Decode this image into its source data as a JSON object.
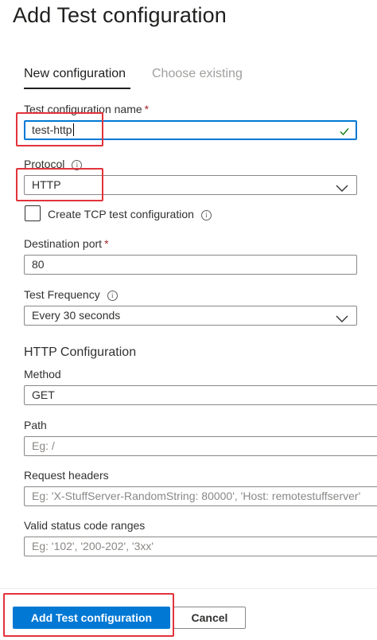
{
  "page_title": "Add Test configuration",
  "tabs": [
    {
      "label": "New configuration",
      "active": true
    },
    {
      "label": "Choose existing",
      "active": false
    }
  ],
  "form": {
    "name": {
      "label": "Test configuration name",
      "required_mark": "*",
      "value": "test-http"
    },
    "protocol": {
      "label": "Protocol",
      "info_icon": "i",
      "value": "HTTP"
    },
    "tcp_checkbox": {
      "label": "Create TCP test configuration",
      "info_icon": "i",
      "checked": false
    },
    "destination_port": {
      "label": "Destination port",
      "required_mark": "*",
      "value": "80"
    },
    "test_frequency": {
      "label": "Test Frequency",
      "info_icon": "i",
      "value": "Every 30 seconds"
    },
    "http_section_title": "HTTP Configuration",
    "method": {
      "label": "Method",
      "value": "GET"
    },
    "path": {
      "label": "Path",
      "placeholder": "Eg: /"
    },
    "request_headers": {
      "label": "Request headers",
      "placeholder": "Eg: 'X-StuffServer-RandomString: 80000', 'Host: remotestuffserver'"
    },
    "status_codes": {
      "label": "Valid status code ranges",
      "placeholder": "Eg: '102', '200-202', '3xx'"
    }
  },
  "buttons": {
    "primary": "Add Test configuration",
    "secondary": "Cancel"
  },
  "colors": {
    "accent": "#0078d4",
    "highlight": "#e2333b",
    "valid_check": "#107c10"
  }
}
